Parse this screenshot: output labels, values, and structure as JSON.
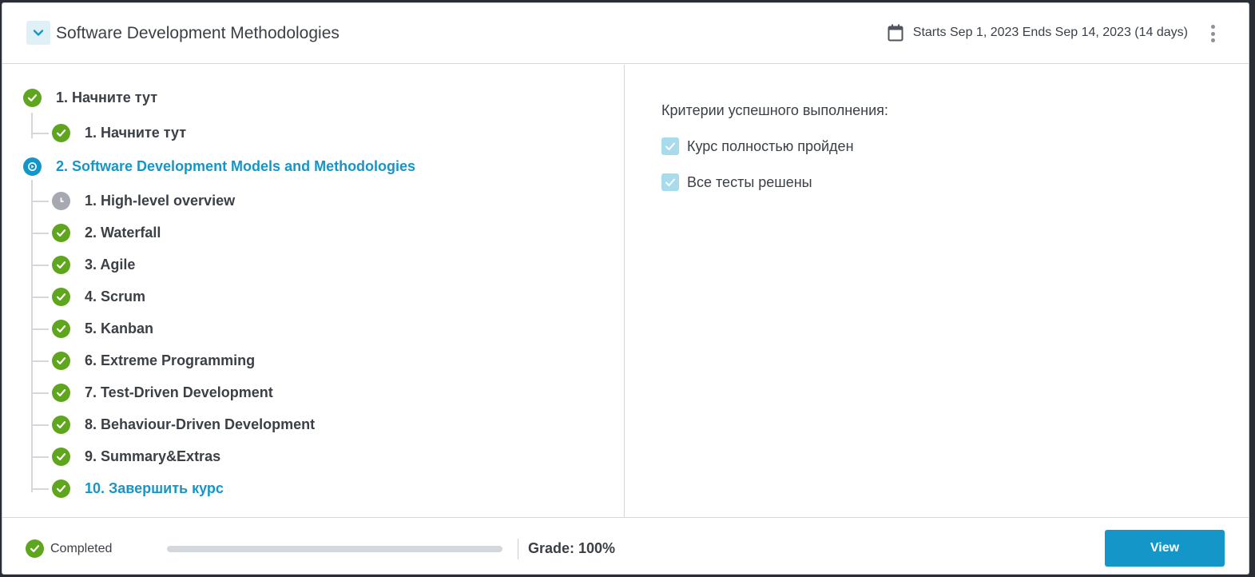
{
  "header": {
    "title": "Software Development Methodologies",
    "dates": "Starts Sep 1, 2023 Ends Sep 14, 2023 (14 days)",
    "calendar_icon": "calendar-icon",
    "more_icon": "more-vertical-icon",
    "collapse_icon": "chevron-down-icon"
  },
  "tree": {
    "sections": [
      {
        "label": "1. Начните тут",
        "status": "done",
        "items": [
          {
            "label": "1. Начните тут",
            "status": "done"
          }
        ]
      },
      {
        "label": "2. Software Development Models and Methodologies",
        "status": "active",
        "items": [
          {
            "label": "1. High-level overview",
            "status": "pending"
          },
          {
            "label": "2. Waterfall",
            "status": "done"
          },
          {
            "label": "3. Agile",
            "status": "done"
          },
          {
            "label": "4. Scrum",
            "status": "done"
          },
          {
            "label": "5. Kanban",
            "status": "done"
          },
          {
            "label": "6. Extreme Programming",
            "status": "done"
          },
          {
            "label": "7. Test-Driven Development",
            "status": "done"
          },
          {
            "label": "8. Behaviour-Driven Development",
            "status": "done"
          },
          {
            "label": "9. Summary&Extras",
            "status": "done"
          },
          {
            "label": "10. Завершить курс",
            "status": "done"
          }
        ]
      }
    ]
  },
  "criteria": {
    "title": "Критерии успешного выполнения:",
    "items": [
      {
        "label": "Курс полностью пройден",
        "checked": true
      },
      {
        "label": "Все тесты решены",
        "checked": true
      }
    ]
  },
  "footer": {
    "status_label": "Completed",
    "progress_fraction": 1.0,
    "grade": "Grade: 100%",
    "view_label": "View"
  },
  "colors": {
    "done": "#5fa51e",
    "active": "#1596c8",
    "pending": "#a7a9b1",
    "accent": "#1596c8"
  }
}
